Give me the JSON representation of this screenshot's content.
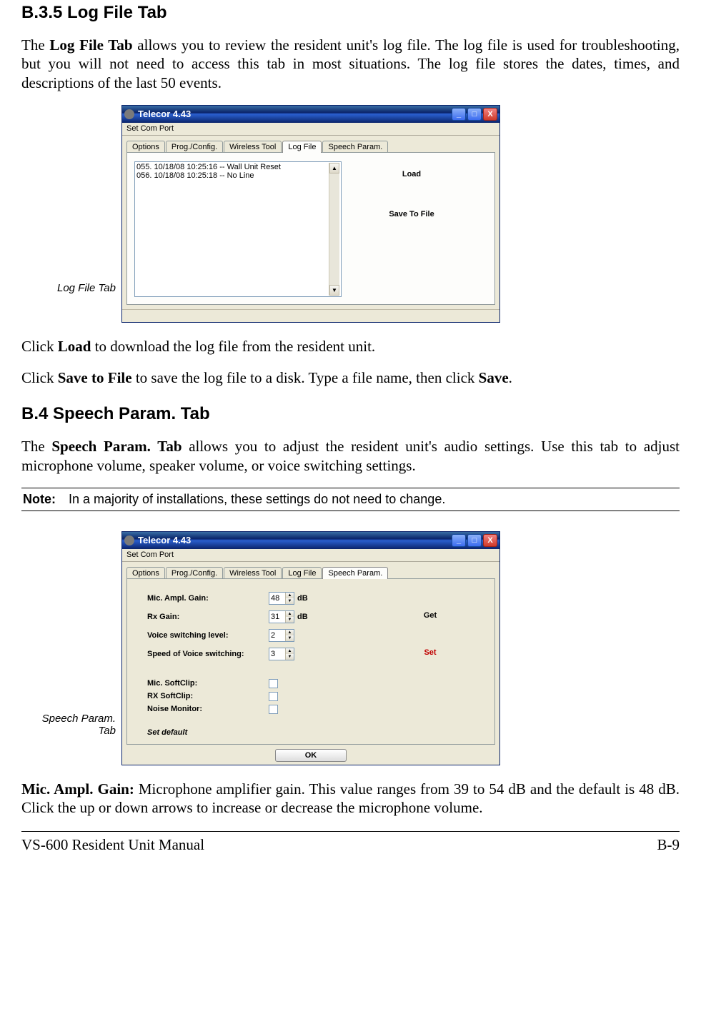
{
  "headings": {
    "h1": "B.3.5        Log File Tab",
    "h2": "B.4    Speech Param. Tab"
  },
  "paras": {
    "p1a": "The ",
    "p1b": "Log File Tab",
    "p1c": " allows you to review the resident unit's log file.  The log file is used for troubleshooting, but you will not need to access this tab in most situations.  The log file stores the dates, times, and descriptions of the last 50 events.",
    "p2a": "Click ",
    "p2b": "Load",
    "p2c": " to download the log file from the resident unit.",
    "p3a": "Click ",
    "p3b": "Save to File",
    "p3c": " to save the log file to a disk.  Type a file name, then click ",
    "p3d": "Save",
    "p3e": ".",
    "p4a": "The ",
    "p4b": "Speech Param. Tab",
    "p4c": " allows you to adjust the resident unit's audio settings.  Use this tab to adjust microphone volume, speaker volume, or voice switching settings.",
    "p5a": "Mic. Ampl. Gain:",
    "p5b": " Microphone amplifier gain.  This value ranges from 39 to 54 dB and the default is 48 dB.  Click the up or down arrows to increase or decrease the microphone volume."
  },
  "captions": {
    "fig1": "Log File Tab",
    "fig2": "Speech Param. Tab"
  },
  "note": {
    "label": "Note:",
    "text": "In a majority of installations, these settings do not need to change."
  },
  "footer": {
    "left": "VS-600 Resident Unit Manual",
    "right": "B-9"
  },
  "win_common": {
    "title": "Telecor 4.43",
    "menu": "Set Com Port",
    "min": "_",
    "max": "□",
    "close": "X",
    "tabs": {
      "options": "Options",
      "prog": "Prog./Config.",
      "wireless": "Wireless Tool",
      "logfile": "Log File",
      "speech": "Speech Param."
    },
    "ok": "OK"
  },
  "log_win": {
    "items": [
      "055.   10/18/08  10:25:16 -- Wall Unit Reset",
      "056.   10/18/08  10:25:18 -- No Line"
    ],
    "btn_load": "Load",
    "btn_save": "Save To File",
    "scroll_up": "▲",
    "scroll_down": "▼"
  },
  "sp_win": {
    "labels": {
      "mic_gain": "Mic. Ampl. Gain:",
      "rx_gain": "Rx Gain:",
      "vsl": "Voice switching level:",
      "vss": "Speed of Voice switching:",
      "mic_sc": "Mic.  SoftClip:",
      "rx_sc": "RX    SoftClip:",
      "noise": "Noise Monitor:",
      "set_default": "Set default",
      "get": "Get",
      "set": "Set",
      "db": "dB"
    },
    "values": {
      "mic_gain": "48",
      "rx_gain": "31",
      "vsl": "2",
      "vss": "3"
    },
    "spin_up": "▲",
    "spin_down": "▼"
  }
}
